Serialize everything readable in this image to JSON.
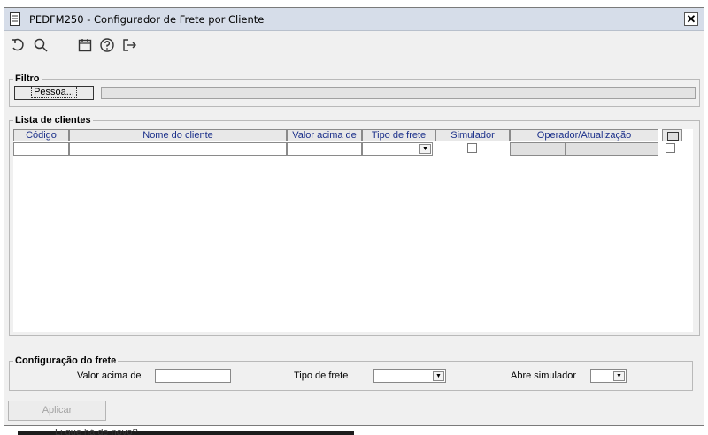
{
  "window": {
    "title": "PEDFM250 - Configurador de Frete por Cliente",
    "close_glyph": "✕"
  },
  "toolbar": {
    "icons": [
      "undo-icon",
      "search-icon",
      "calendar-icon",
      "help-icon",
      "exit-icon"
    ]
  },
  "filtro": {
    "legend": "Filtro",
    "pessoa_button": "Pessoa...",
    "pessoa_value": ""
  },
  "clientes": {
    "legend": "Lista de clientes",
    "columns": [
      "Código",
      "Nome do cliente",
      "Valor acima de",
      "Tipo de frete",
      "Simulador",
      "Operador/Atualização"
    ],
    "rows": [
      {
        "codigo": "",
        "nome": "",
        "valor": "",
        "tipo": "",
        "simulador": false,
        "operador": "",
        "atualizacao": "",
        "selecionado": false
      }
    ]
  },
  "config": {
    "legend": "Configuração do frete",
    "valor_label": "Valor acima de",
    "valor_value": "",
    "tipo_label": "Tipo de frete",
    "tipo_value": "",
    "simulador_label": "Abre simulador",
    "simulador_value": ""
  },
  "footer": {
    "aplicar_label": "Aplicar",
    "aplicar_enabled": false
  },
  "background": {
    "partial_text": "Li que há de novo?"
  },
  "colors": {
    "titlebar": "#d6dde9",
    "header_text": "#1a2f8a",
    "window_bg": "#f0f0f0"
  }
}
